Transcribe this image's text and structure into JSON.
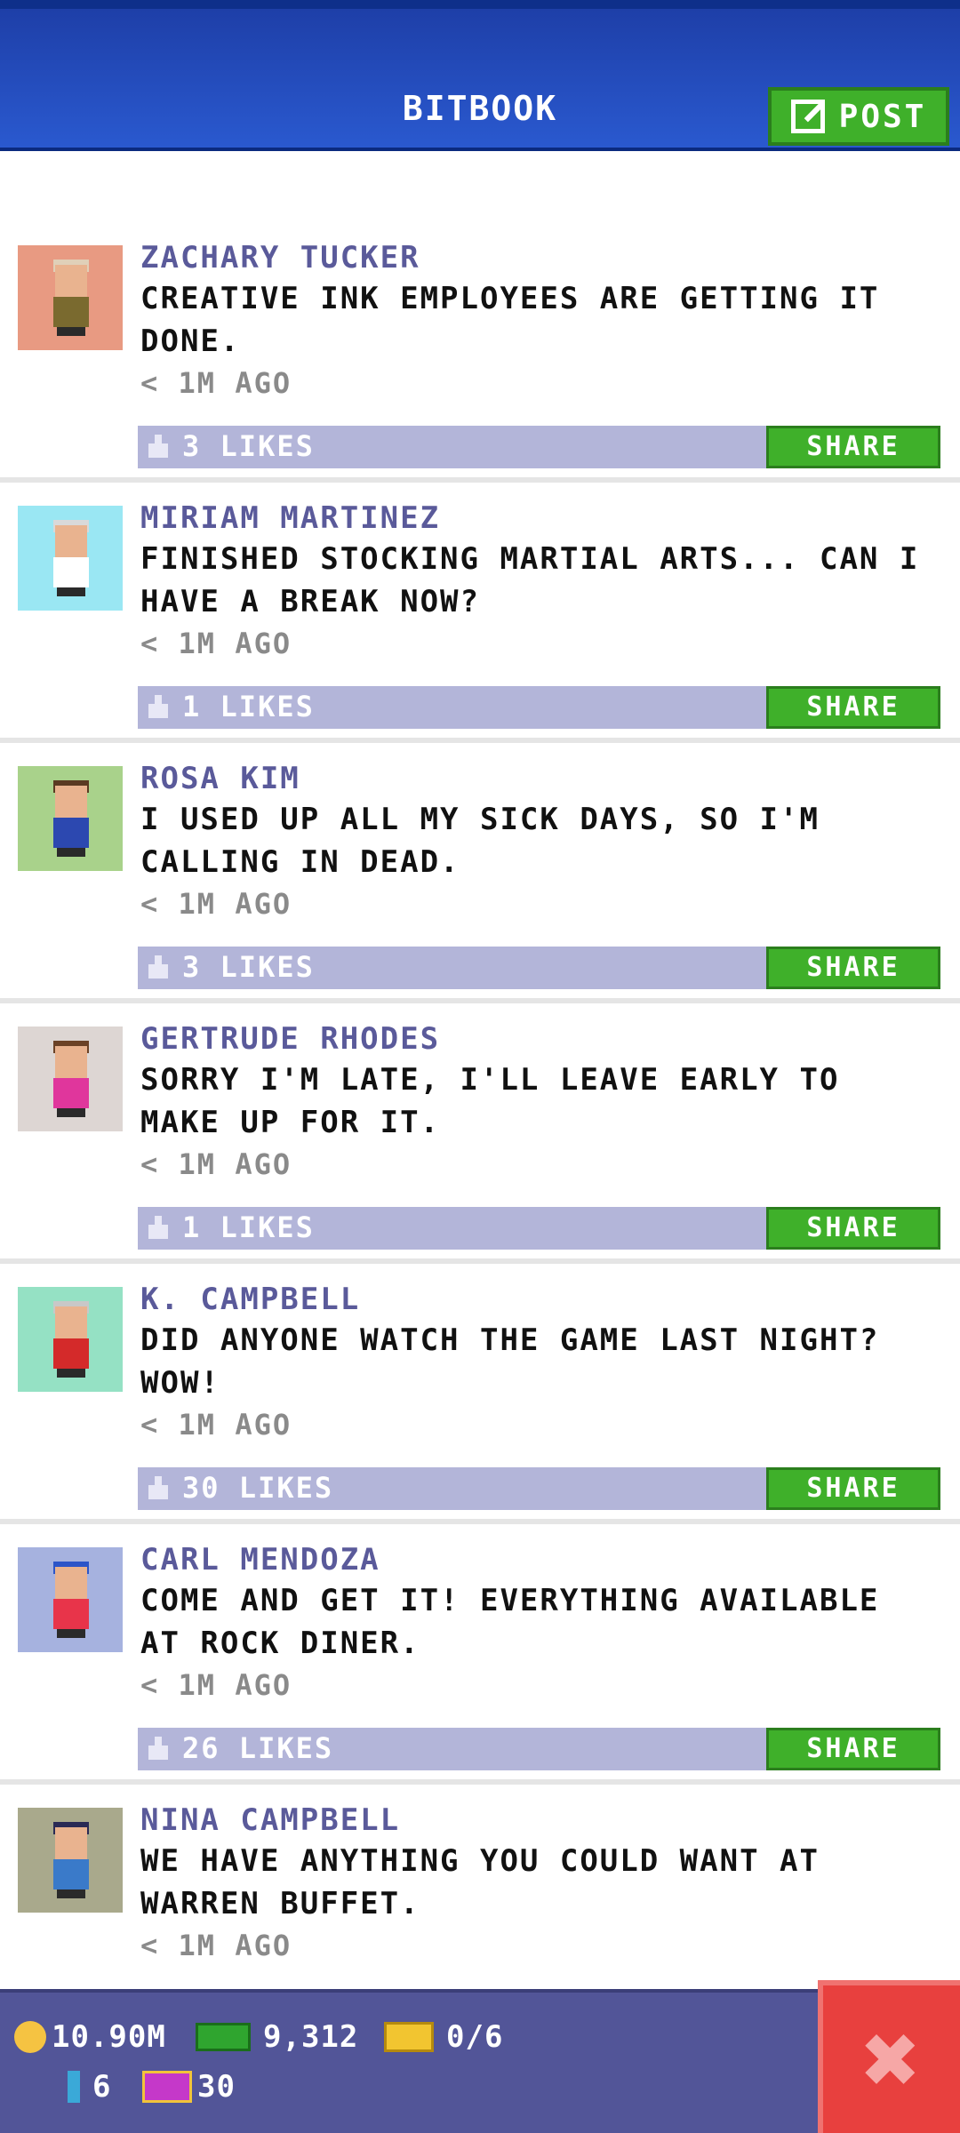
{
  "header": {
    "title": "BITBOOK",
    "post_label": "POST"
  },
  "posts": [
    {
      "author": "ZACHARY TUCKER",
      "message": "CREATIVE INK EMPLOYEES ARE GETTING IT DONE.",
      "time": "< 1M AGO",
      "likes": "3 LIKES",
      "share": "SHARE"
    },
    {
      "author": "MIRIAM MARTINEZ",
      "message": "FINISHED STOCKING MARTIAL ARTS... CAN I HAVE A BREAK NOW?",
      "time": "< 1M AGO",
      "likes": "1 LIKES",
      "share": "SHARE"
    },
    {
      "author": "ROSA KIM",
      "message": "I USED UP ALL MY SICK DAYS, SO I'M CALLING IN DEAD.",
      "time": "< 1M AGO",
      "likes": "3 LIKES",
      "share": "SHARE"
    },
    {
      "author": "GERTRUDE RHODES",
      "message": "SORRY I'M LATE, I'LL LEAVE EARLY TO MAKE UP FOR IT.",
      "time": "< 1M AGO",
      "likes": "1 LIKES",
      "share": "SHARE"
    },
    {
      "author": "K. CAMPBELL",
      "message": "DID ANYONE WATCH THE GAME LAST NIGHT? WOW!",
      "time": "< 1M AGO",
      "likes": "30 LIKES",
      "share": "SHARE"
    },
    {
      "author": "CARL MENDOZA",
      "message": "COME AND GET IT! EVERYTHING AVAILABLE AT ROCK DINER.",
      "time": "< 1M AGO",
      "likes": "26 LIKES",
      "share": "SHARE"
    },
    {
      "author": "NINA CAMPBELL",
      "message": "WE HAVE ANYTHING YOU COULD WANT AT WARREN BUFFET.",
      "time": "< 1M AGO"
    }
  ],
  "avatar_colors": {
    "bg": [
      "#e89a82",
      "#9ae7f3",
      "#a9d28b",
      "#ddd6d3",
      "#95e1c4",
      "#a6b2df",
      "#a9a98c"
    ],
    "shirt": [
      "#7a6a2f",
      "#ffffff",
      "#2c48b0",
      "#e0369c",
      "#d42a2a",
      "#e8344a",
      "#3a7ac9"
    ],
    "hair": [
      "#e0d0b8",
      "#d9d9d9",
      "#5a3a22",
      "#6b4226",
      "#c8c8c8",
      "#2c55c8",
      "#2a2a55"
    ]
  },
  "status": {
    "coins": "10.90M",
    "cash": "9,312",
    "tickets": "0/6",
    "bux": "6",
    "vip": "30"
  },
  "close_label": "✖"
}
